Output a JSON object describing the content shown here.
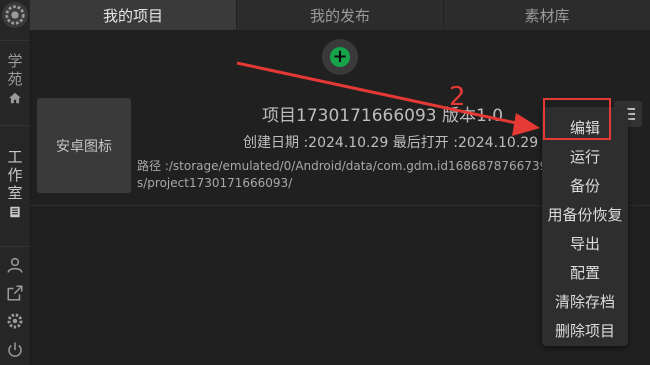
{
  "tabs": [
    {
      "label": "我的项目",
      "active": true
    },
    {
      "label": "我的发布",
      "active": false
    },
    {
      "label": "素材库",
      "active": false
    }
  ],
  "sidebar": {
    "logo_icon": "gear-logo-icon",
    "academy_label": "学苑",
    "academy_icon": "home-icon",
    "studio_label": "工作室",
    "studio_icon": "book-icon",
    "bottom_icons": [
      "user-icon",
      "external-link-icon",
      "settings-icon",
      "power-icon"
    ]
  },
  "add_button_icon": "plus-circle-icon",
  "project": {
    "thumbnail_label": "安卓图标",
    "title": "项目1730171666093  版本1.0",
    "dates": "创建日期 :2024.10.29   最后打开 :2024.10.29",
    "path": "路径 :/storage/emulated/0/Android/data/com.gdm.id1686878766739/files/Projects/project1730171666093/"
  },
  "menu_toggle_icon": "hamburger-icon",
  "menu": {
    "items": [
      "编辑",
      "运行",
      "备份",
      "用备份恢复",
      "导出",
      "配置",
      "清除存档",
      "删除项目"
    ]
  },
  "annotation": {
    "step_number": "2",
    "color": "#e53935"
  },
  "colors": {
    "accent_green": "#16a34a",
    "background": "#202020",
    "active_tab": "#3a3a3a"
  }
}
